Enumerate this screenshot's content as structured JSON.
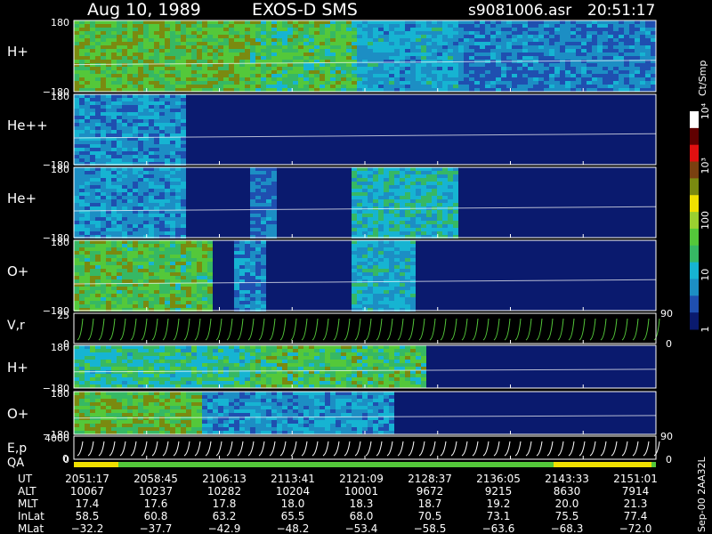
{
  "header": {
    "date": "Aug 10, 1989",
    "instrument": "EXOS-D SMS",
    "file": "s9081006.asr",
    "time": "20:51:17"
  },
  "colors": {
    "background": "#000000",
    "low": "#0a1a6e",
    "cyan": "#16b4d2",
    "green": "#54c83a",
    "olive": "#7a8a10",
    "yellow": "#f0e000",
    "red": "#e01010",
    "white": "#ffffff"
  },
  "colorbar": {
    "unit": "Ct/Smp",
    "ticks": [
      "1",
      "10",
      "100",
      "10³",
      "10⁴"
    ]
  },
  "side_label": "Sep-00 2AA32L",
  "chart_data": [
    {
      "type": "heatmap",
      "panel": "H+",
      "label": "H+",
      "ylim": [
        -180,
        180
      ],
      "ticks": [
        "180",
        "−180"
      ],
      "activity": [
        {
          "from": 0.0,
          "to": 0.3,
          "level": 2.6
        },
        {
          "from": 0.3,
          "to": 0.48,
          "level": 2.4
        },
        {
          "from": 0.48,
          "to": 0.66,
          "level": 1.5
        },
        {
          "from": 0.66,
          "to": 1.0,
          "level": 1.1
        }
      ]
    },
    {
      "type": "heatmap",
      "panel": "He++",
      "label": "He++",
      "ylim": [
        -180,
        180
      ],
      "ticks": [
        "180",
        "−180"
      ],
      "activity": [
        {
          "from": 0.0,
          "to": 0.19,
          "level": 1.2
        },
        {
          "from": 0.19,
          "to": 1.0,
          "level": 0.1
        }
      ]
    },
    {
      "type": "heatmap",
      "panel": "He+",
      "label": "He+",
      "ylim": [
        -180,
        180
      ],
      "ticks": [
        "180",
        "−180"
      ],
      "activity": [
        {
          "from": 0.0,
          "to": 0.19,
          "level": 1.3
        },
        {
          "from": 0.3,
          "to": 0.34,
          "level": 1.0
        },
        {
          "from": 0.47,
          "to": 0.66,
          "level": 1.8
        },
        {
          "from": 0.19,
          "to": 1.0,
          "level": 0.1
        }
      ]
    },
    {
      "type": "heatmap",
      "panel": "O+",
      "label": "O+",
      "ylim": [
        -180,
        180
      ],
      "ticks": [
        "180",
        "−180"
      ],
      "activity": [
        {
          "from": 0.0,
          "to": 0.23,
          "level": 2.5
        },
        {
          "from": 0.27,
          "to": 0.33,
          "level": 1.2
        },
        {
          "from": 0.47,
          "to": 0.58,
          "level": 1.6
        },
        {
          "from": 0.23,
          "to": 1.0,
          "level": 0.1
        }
      ]
    },
    {
      "type": "line",
      "panel": "V,r",
      "label": "V,r",
      "ylim": [
        0,
        25
      ],
      "ticks": [
        "25",
        "0"
      ],
      "right_ticks": [
        "90",
        "0"
      ]
    },
    {
      "type": "heatmap",
      "panel": "H+ (V,r)",
      "label": "H+",
      "ylim": [
        -180,
        180
      ],
      "ticks": [
        "180",
        "−180"
      ],
      "activity": [
        {
          "from": 0.0,
          "to": 0.3,
          "level": 2.0
        },
        {
          "from": 0.3,
          "to": 0.6,
          "level": 2.4
        },
        {
          "from": 0.6,
          "to": 1.0,
          "level": 0.1
        }
      ]
    },
    {
      "type": "heatmap",
      "panel": "O+ (V,r)",
      "label": "O+",
      "ylim": [
        -180,
        180
      ],
      "ticks": [
        "180",
        "−180"
      ],
      "activity": [
        {
          "from": 0.0,
          "to": 0.22,
          "level": 2.6
        },
        {
          "from": 0.22,
          "to": 0.55,
          "level": 1.3
        },
        {
          "from": 0.55,
          "to": 1.0,
          "level": 0.1
        }
      ]
    },
    {
      "type": "line",
      "panel": "E,p",
      "label": "E,p",
      "ylim": [
        0,
        4000
      ],
      "ticks": [
        "4000",
        "0"
      ],
      "right_ticks": [
        "90",
        "0"
      ]
    }
  ],
  "qa": {
    "label": "QA",
    "tick": "0"
  },
  "table": {
    "rows": [
      {
        "label": "UT",
        "values": [
          "2051:17",
          "2058:45",
          "2106:13",
          "2113:41",
          "2121:09",
          "2128:37",
          "2136:05",
          "2143:33",
          "2151:01"
        ]
      },
      {
        "label": "ALT",
        "values": [
          "10067",
          "10237",
          "10282",
          "10204",
          "10001",
          "9672",
          "9215",
          "8630",
          "7914"
        ]
      },
      {
        "label": "MLT",
        "values": [
          "17.4",
          "17.6",
          "17.8",
          "18.0",
          "18.3",
          "18.7",
          "19.2",
          "20.0",
          "21.3"
        ]
      },
      {
        "label": "InLat",
        "values": [
          "58.5",
          "60.8",
          "63.2",
          "65.5",
          "68.0",
          "70.5",
          "73.1",
          "75.5",
          "77.4"
        ]
      },
      {
        "label": "MLat",
        "values": [
          "−32.2",
          "−37.7",
          "−42.9",
          "−48.2",
          "−53.4",
          "−58.5",
          "−63.6",
          "−68.3",
          "−72.0"
        ]
      }
    ]
  }
}
